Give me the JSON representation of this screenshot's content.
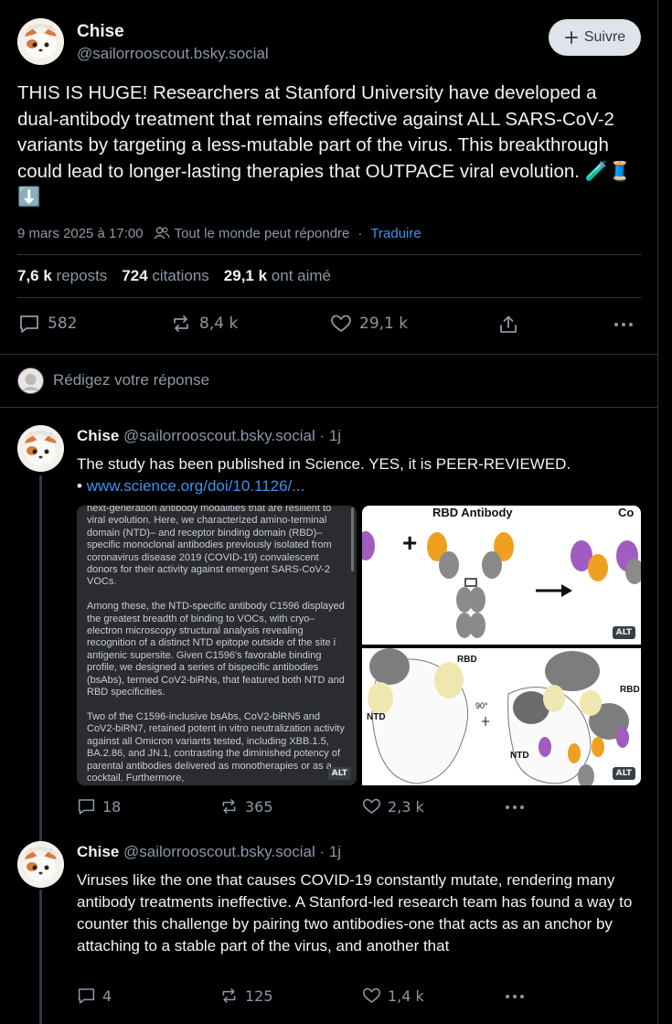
{
  "post": {
    "author_name": "Chise",
    "author_handle": "@sailorrooscout.bsky.social",
    "follow_label": "Suivre",
    "text": "THIS IS HUGE! Researchers at Stanford University have developed a dual-antibody treatment that remains effective against ALL SARS-CoV-2 variants by targeting a less-mutable part of the virus. This breakthrough could lead to longer-lasting therapies that OUTPACE viral evolution. 🧪🧵⬇️",
    "timestamp": "9 mars 2025 à 17:00",
    "reply_setting": "Tout le monde peut répondre",
    "translate": "Traduire",
    "stats": {
      "reposts_count": "7,6 k",
      "reposts_label": "reposts",
      "quotes_count": "724",
      "quotes_label": "citations",
      "likes_count": "29,1 k",
      "likes_label": "ont aimé"
    },
    "actions": {
      "replies": "582",
      "reposts": "8,4 k",
      "likes": "29,1 k"
    }
  },
  "reply_prompt": "Rédigez votre réponse",
  "replies": [
    {
      "author_name": "Chise",
      "author_handle": "@sailorrooscout.bsky.social · 1j",
      "text": "The study has been published in Science. YES, it is PEER-REVIEWED.",
      "bullet": "•",
      "link": "www.science.org/doi/10.1126/...",
      "abstract_text": "next-generation antibody modalities that are resilient to viral evolution. Here, we characterized amino-terminal domain (NTD)– and receptor binding domain (RBD)–specific monoclonal antibodies previously isolated from coronavirus disease 2019 (COVID-19) convalescent donors for their activity against emergent SARS-CoV-2 VOCs.\n\nAmong these, the NTD-specific antibody C1596 displayed the greatest breadth of binding to VOCs, with cryo–electron microscopy structural analysis revealing recognition of a distinct NTD epitope outside of the site i antigenic supersite. Given C1596's favorable binding profile, we designed a series of bispecific antibodies (bsAbs), termed CoV2-biRNs, that featured both NTD and RBD specificities.\n\nTwo of the C1596-inclusive bsAbs, CoV2-biRN5 and CoV2-biRN7, retained potent in vitro neutralization activity against all Omicron variants tested, including XBB.1.5, BA.2.86, and JN.1, contrasting the diminished potency of parental antibodies delivered as monotherapies or as a cocktail. Furthermore,",
      "fig_rbd_antibody": "RBD Antibody",
      "fig_co": "Co",
      "fig_rbd_left": "RBD",
      "fig_rbd_right": "RBD",
      "fig_ntd_left": "NTD",
      "fig_ntd_center": "NTD",
      "fig_angle": "90°",
      "alt_label": "ALT",
      "actions": {
        "replies": "18",
        "reposts": "365",
        "likes": "2,3 k"
      }
    },
    {
      "author_name": "Chise",
      "author_handle": "@sailorrooscout.bsky.social · 1j",
      "text": "Viruses like the one that causes COVID-19 constantly mutate, rendering many antibody treatments ineffective. A Stanford-led research team has found a way to counter this challenge by pairing two antibodies-one that acts as an anchor by attaching to a stable part of the virus, and another that",
      "actions": {
        "replies": "4",
        "reposts": "125",
        "likes": "1,4 k"
      }
    }
  ],
  "colors": {
    "background": "#000000",
    "accent": "#3b93ee",
    "muted": "#8b98a5",
    "divider": "#2e3640"
  }
}
